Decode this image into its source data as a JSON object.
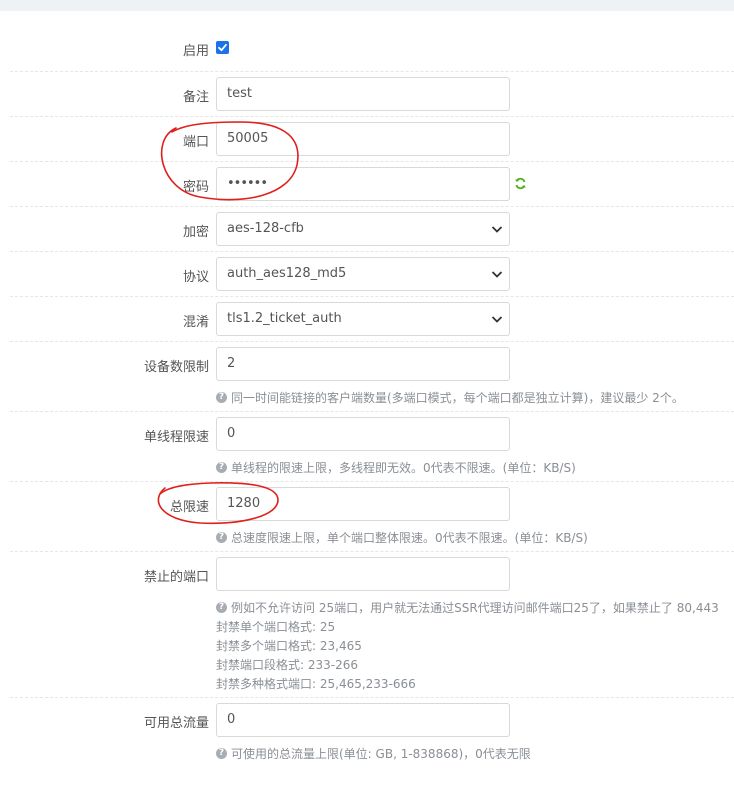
{
  "form": {
    "enable": {
      "label": "启用",
      "checked": true
    },
    "remark": {
      "label": "备注",
      "value": "test"
    },
    "port": {
      "label": "端口",
      "value": "50005"
    },
    "password": {
      "label": "密码",
      "value": "••••••"
    },
    "encryption": {
      "label": "加密",
      "value": "aes-128-cfb"
    },
    "protocol": {
      "label": "协议",
      "value": "auth_aes128_md5"
    },
    "obfs": {
      "label": "混淆",
      "value": "tls1.2_ticket_auth"
    },
    "device_limit": {
      "label": "设备数限制",
      "value": "2",
      "help": "同一时间能链接的客户端数量(多端口模式，每个端口都是独立计算)，建议最少 2个。"
    },
    "thread_speed": {
      "label": "单线程限速",
      "value": "0",
      "help": "单线程的限速上限，多线程即无效。0代表不限速。(单位：KB/S)"
    },
    "total_speed": {
      "label": "总限速",
      "value": "1280",
      "help": "总速度限速上限，单个端口整体限速。0代表不限速。(单位：KB/S)"
    },
    "blocked_ports": {
      "label": "禁止的端口",
      "value": "",
      "help": "例如不允许访问 25端口，用户就无法通过SSR代理访问邮件端口25了，如果禁止了 80,443",
      "formats": [
        "封禁单个端口格式: 25",
        "封禁多个端口格式: 23,465",
        "封禁端口段格式: 233-266",
        "封禁多种格式端口: 25,465,233-666"
      ]
    },
    "traffic": {
      "label": "可用总流量",
      "value": "0",
      "help": "可使用的总流量上限(单位: GB, 1-838868)，0代表无限"
    }
  },
  "colors": {
    "accent": "#1a73e8",
    "annotation": "#e0201c",
    "refresh": "#4caf1a"
  }
}
